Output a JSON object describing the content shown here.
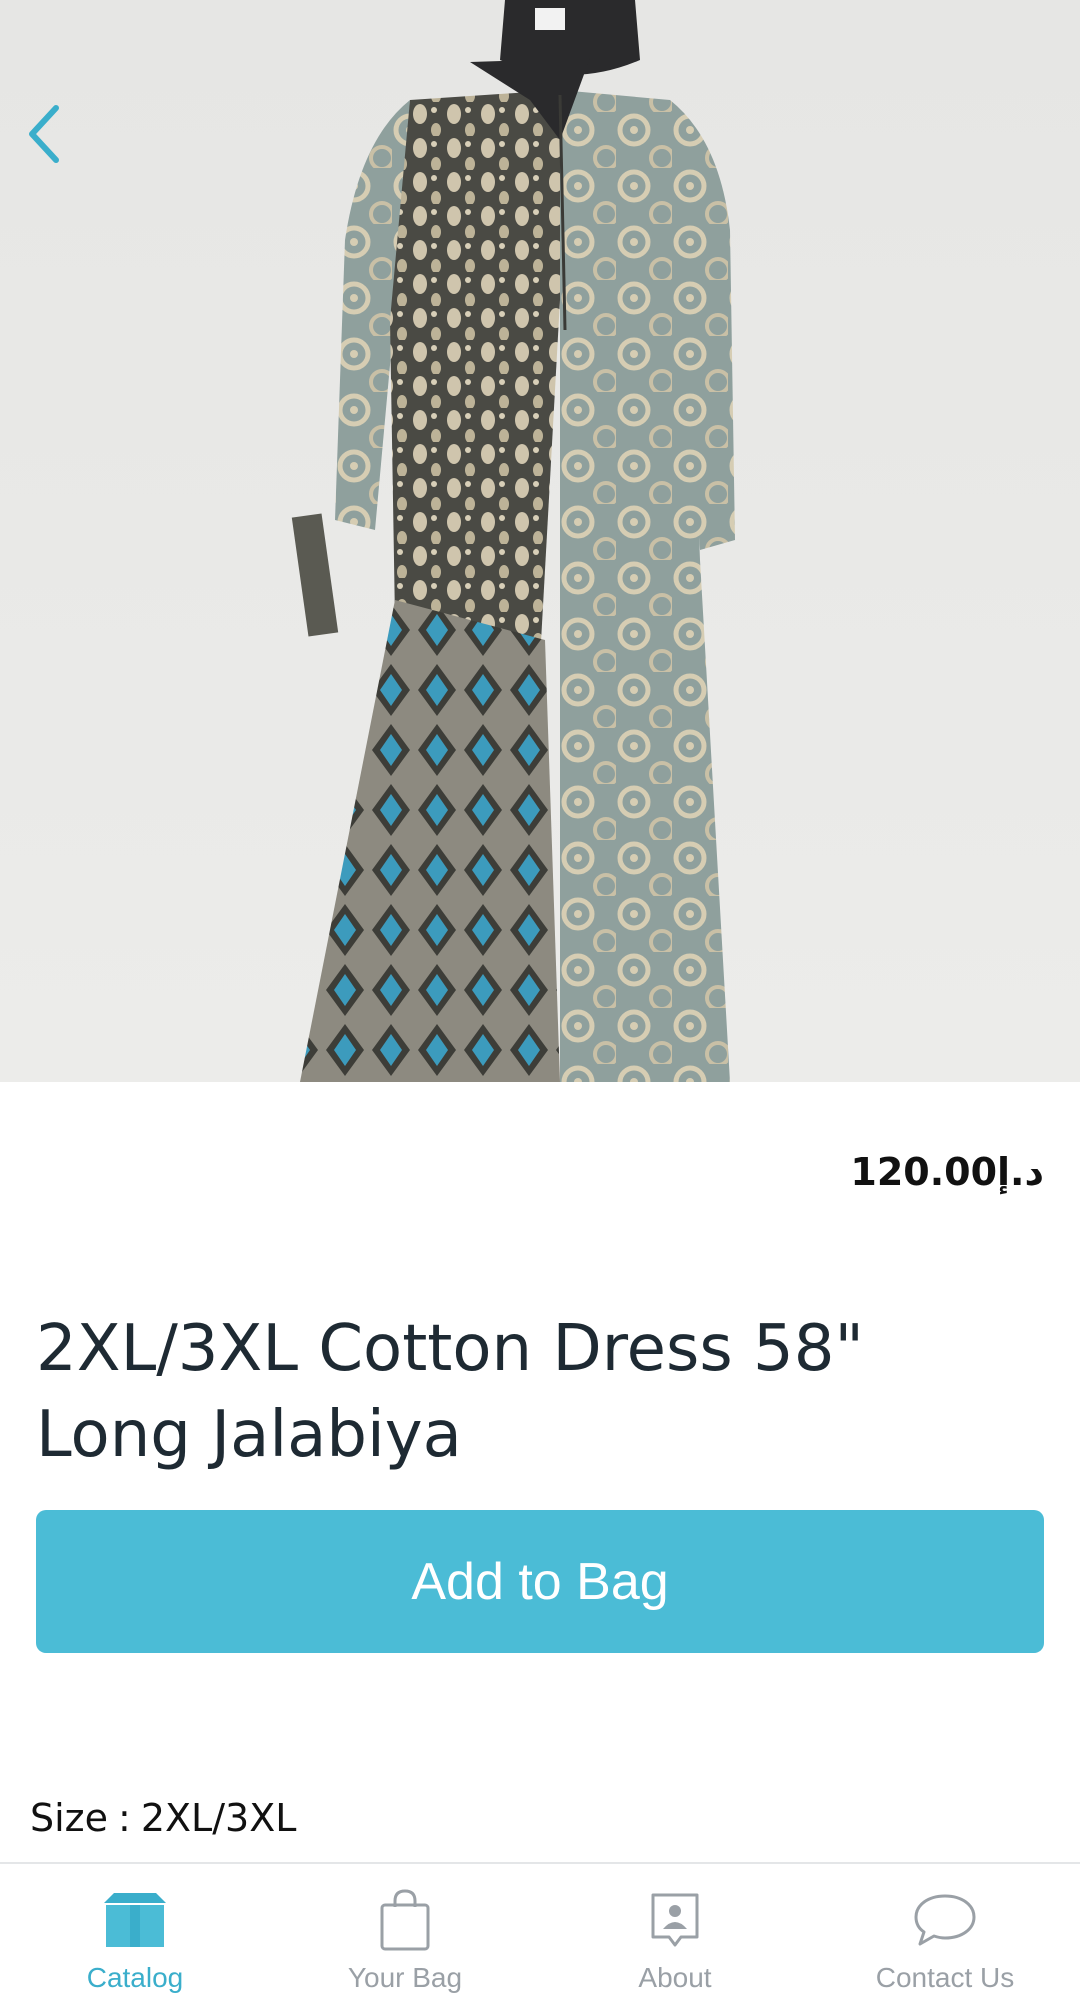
{
  "colors": {
    "accent": "#4bbcd6",
    "accent_dark": "#3aaecb",
    "inactive": "#9aa0a6",
    "title_text": "#1e2a33"
  },
  "header": {
    "back_icon": "chevron-left-icon"
  },
  "product": {
    "image_alt": "Product photo",
    "price": "د.إ120.00",
    "title": "2XL/3XL Cotton Dress 58\" Long Jalabiya",
    "size_label": "Size",
    "size_separator": ":",
    "size_value": "2XL/3XL"
  },
  "actions": {
    "add_to_bag_label": "Add to Bag"
  },
  "tabbar": {
    "tabs": [
      {
        "label": "Catalog",
        "icon": "box-icon",
        "active": true
      },
      {
        "label": "Your Bag",
        "icon": "shopping-bag-icon",
        "active": false
      },
      {
        "label": "About",
        "icon": "contact-card-icon",
        "active": false
      },
      {
        "label": "Contact Us",
        "icon": "chat-bubble-icon",
        "active": false
      }
    ]
  }
}
